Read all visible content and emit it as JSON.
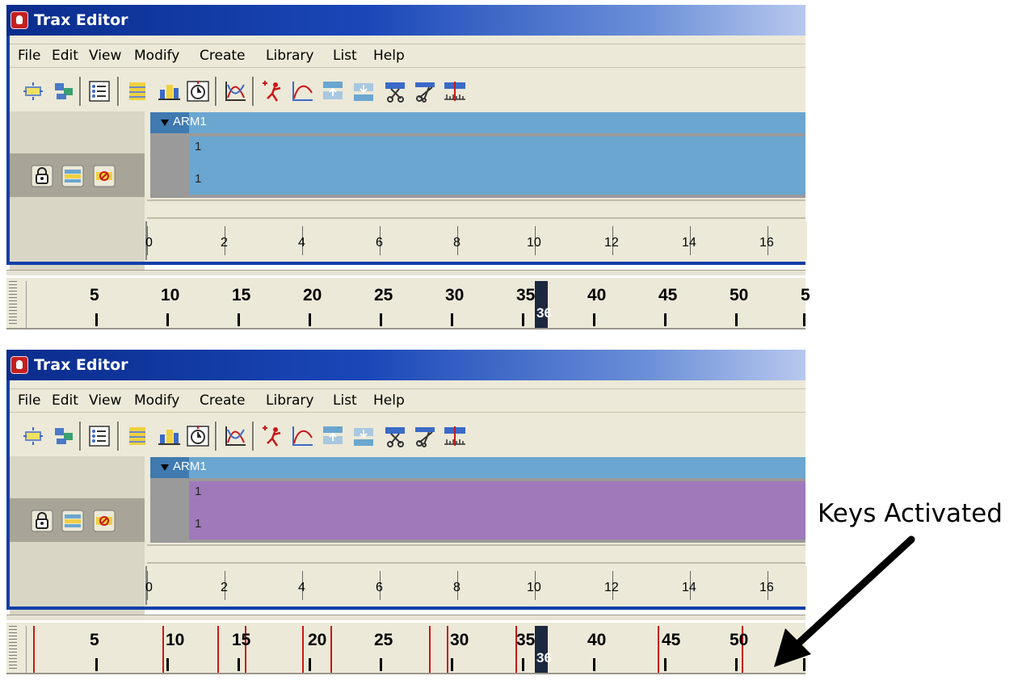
{
  "window": {
    "title": "Trax Editor"
  },
  "menu": [
    "File",
    "Edit",
    "View",
    "Modify",
    "Create",
    "Library",
    "List",
    "Help"
  ],
  "toolbar_icons": [
    "create-blend-icon",
    "create-clip-icon",
    "outliner-icon",
    "insert-clip-icon",
    "graph-anim-icon",
    "time-warp-icon",
    "graph-editor-icon",
    "set-key-icon",
    "curve-icon",
    "move-up-icon",
    "move-down-icon",
    "split-clip-icon",
    "cut-clip-icon",
    "ruler-icon"
  ],
  "track_controls": [
    "lock-icon",
    "mute-icon",
    "solo-icon"
  ],
  "track": {
    "name": "ARM1",
    "clip_label_top": "1",
    "clip_label_bottom": "1"
  },
  "ruler_labels": [
    "0",
    "2",
    "4",
    "6",
    "8",
    "10",
    "12",
    "14",
    "16"
  ],
  "timeline": {
    "labels": [
      "5",
      "10",
      "15",
      "20",
      "25",
      "30",
      "35",
      "40",
      "45",
      "50",
      "5"
    ],
    "current_frame": "36"
  },
  "panels": [
    {
      "id": "top",
      "clip_color": "#6aa6d0",
      "keys_activated": false
    },
    {
      "id": "bottom",
      "clip_color": "#a079bb",
      "keys_activated": true
    }
  ],
  "annotation": {
    "text": "Keys Activated"
  }
}
